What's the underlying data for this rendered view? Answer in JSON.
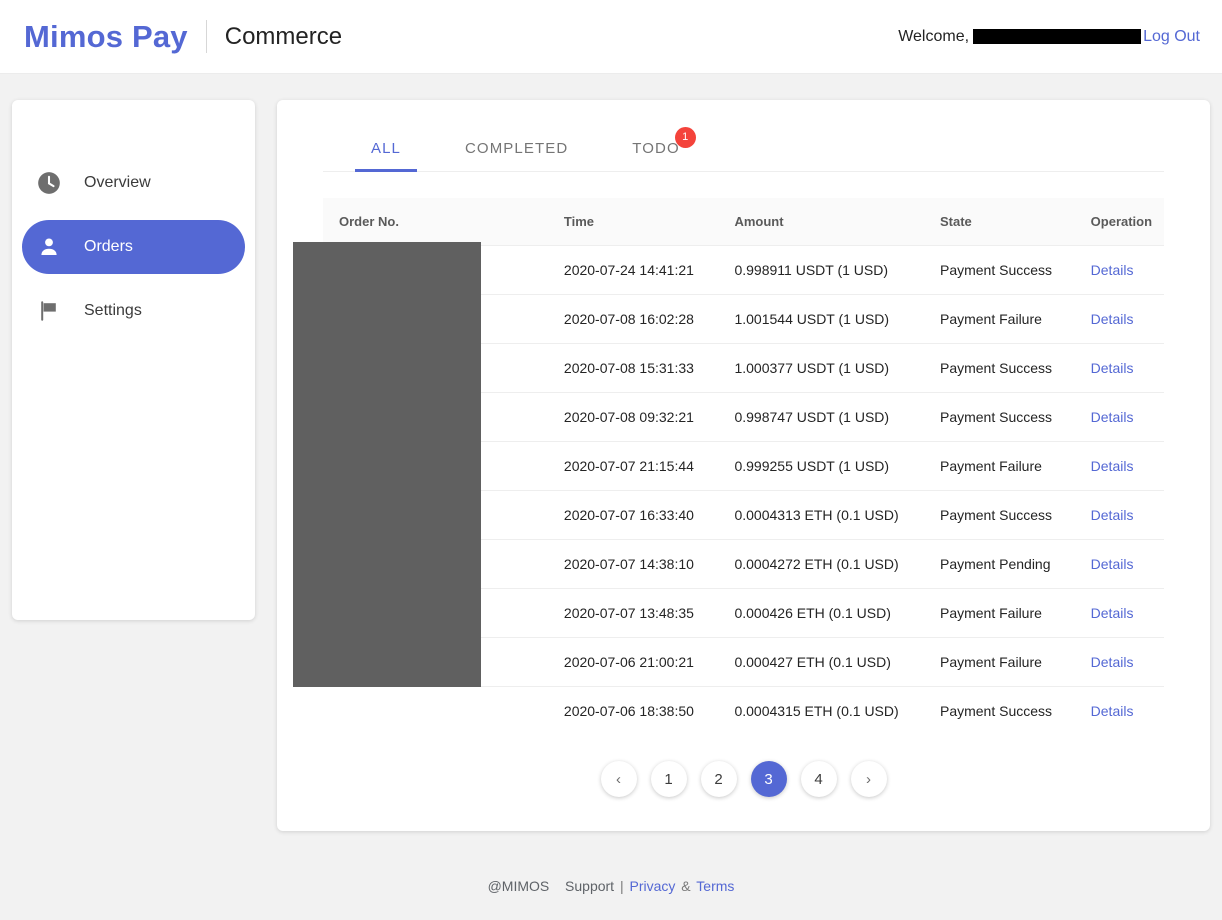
{
  "header": {
    "brand": "Mimos Pay",
    "subtitle": "Commerce",
    "welcome_label": "Welcome,",
    "welcome_email_redacted": "",
    "logout_label": "Log Out",
    "brand_color": "#5468d4",
    "link_color": "#5468d4"
  },
  "sidebar": {
    "items": [
      {
        "label": "Overview",
        "icon": "clock-icon",
        "active": false
      },
      {
        "label": "Orders",
        "icon": "person-icon",
        "active": true
      },
      {
        "label": "Settings",
        "icon": "flag-icon",
        "active": false
      }
    ],
    "active_color": "#5468d4"
  },
  "tabs": [
    {
      "label": "ALL",
      "active": true,
      "badge": ""
    },
    {
      "label": "COMPLETED",
      "active": false,
      "badge": ""
    },
    {
      "label": "TODO",
      "active": false,
      "badge": "1"
    }
  ],
  "badge_color": "#f4433b",
  "table": {
    "columns": [
      "Order No.",
      "Time",
      "Amount",
      "State",
      "Operation"
    ],
    "rows": [
      {
        "order_no": "",
        "time": "2020-07-24 14:41:21",
        "amount": "0.998911 USDT (1 USD)",
        "state": "Payment Success",
        "operation": "Details"
      },
      {
        "order_no": "",
        "time": "2020-07-08 16:02:28",
        "amount": "1.001544 USDT (1 USD)",
        "state": "Payment Failure",
        "operation": "Details"
      },
      {
        "order_no": "",
        "time": "2020-07-08 15:31:33",
        "amount": "1.000377 USDT (1 USD)",
        "state": "Payment Success",
        "operation": "Details"
      },
      {
        "order_no": "",
        "time": "2020-07-08 09:32:21",
        "amount": "0.998747 USDT (1 USD)",
        "state": "Payment Success",
        "operation": "Details"
      },
      {
        "order_no": "",
        "time": "2020-07-07 21:15:44",
        "amount": "0.999255 USDT (1 USD)",
        "state": "Payment Failure",
        "operation": "Details"
      },
      {
        "order_no": "",
        "time": "2020-07-07 16:33:40",
        "amount": "0.0004313 ETH (0.1 USD)",
        "state": "Payment Success",
        "operation": "Details"
      },
      {
        "order_no": "",
        "time": "2020-07-07 14:38:10",
        "amount": "0.0004272 ETH (0.1 USD)",
        "state": "Payment Pending",
        "operation": "Details"
      },
      {
        "order_no": "",
        "time": "2020-07-07 13:48:35",
        "amount": "0.000426 ETH (0.1 USD)",
        "state": "Payment Failure",
        "operation": "Details"
      },
      {
        "order_no": "",
        "time": "2020-07-06 21:00:21",
        "amount": "0.000427 ETH (0.1 USD)",
        "state": "Payment Failure",
        "operation": "Details"
      },
      {
        "order_no": "",
        "time": "2020-07-06 18:38:50",
        "amount": "0.0004315 ETH (0.1 USD)",
        "state": "Payment Success",
        "operation": "Details"
      }
    ]
  },
  "pagination": {
    "prev": "‹",
    "next": "›",
    "pages": [
      "1",
      "2",
      "3",
      "4"
    ],
    "current": "3"
  },
  "footer": {
    "copyright": "@MIMOS",
    "support": "Support",
    "divider": "|",
    "privacy": "Privacy",
    "amp": "&",
    "terms": "Terms"
  }
}
